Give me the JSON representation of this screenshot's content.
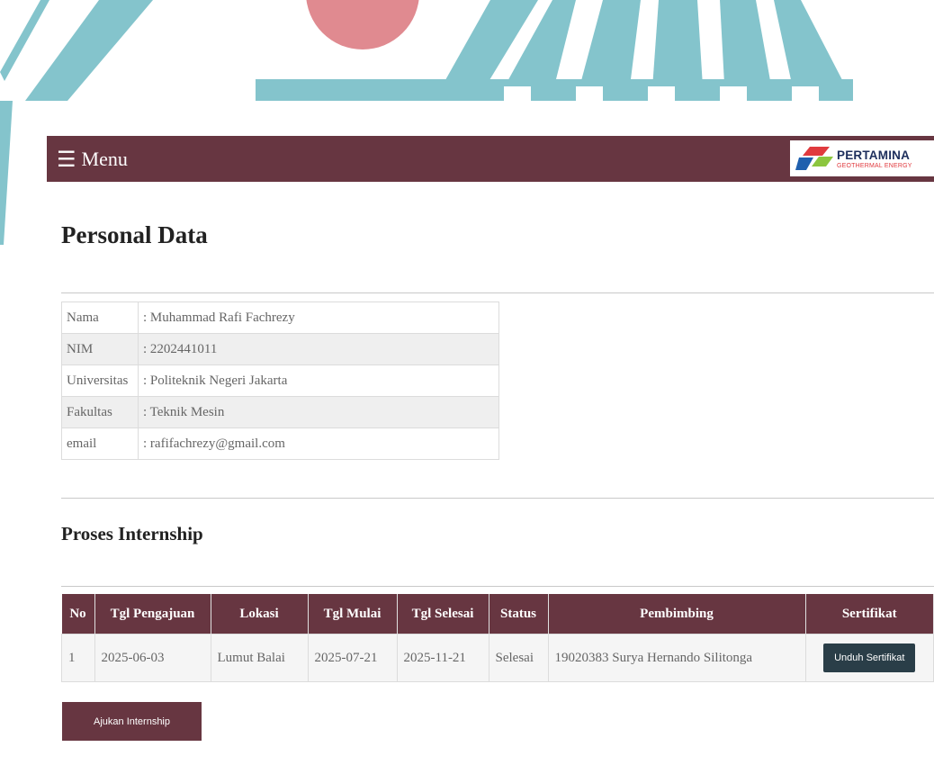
{
  "colors": {
    "accent": "#673641",
    "button_dark": "#2a3e48",
    "banner_teal": "#84c4cc",
    "banner_pink": "#e08a90"
  },
  "navbar": {
    "menu_icon": "hamburger-icon",
    "menu_label": "Menu",
    "logo": {
      "name": "PERTAMINA",
      "subtitle": "GEOTHERMAL ENERGY"
    }
  },
  "page_title": "Personal Data",
  "personal_data": [
    {
      "label": "Nama",
      "value": ": Muhammad Rafi Fachrezy"
    },
    {
      "label": "NIM",
      "value": ": 2202441011"
    },
    {
      "label": "Universitas",
      "value": ": Politeknik Negeri Jakarta"
    },
    {
      "label": "Fakultas",
      "value": ": Teknik Mesin"
    },
    {
      "label": "email",
      "value": ": rafifachrezy@gmail.com"
    }
  ],
  "internship": {
    "title": "Proses Internship",
    "headers": [
      "No",
      "Tgl Pengajuan",
      "Lokasi",
      "Tgl Mulai",
      "Tgl Selesai",
      "Status",
      "Pembimbing",
      "Sertifikat"
    ],
    "rows": [
      {
        "no": "1",
        "tgl_pengajuan": "2025-06-03",
        "lokasi": "Lumut Balai",
        "tgl_mulai": "2025-07-21",
        "tgl_selesai": "2025-11-21",
        "status": "Selesai",
        "pembimbing": "19020383 Surya Hernando Silitonga",
        "sertifikat_button": "Unduh Sertifikat"
      }
    ],
    "apply_button": "Ajukan Internship"
  }
}
